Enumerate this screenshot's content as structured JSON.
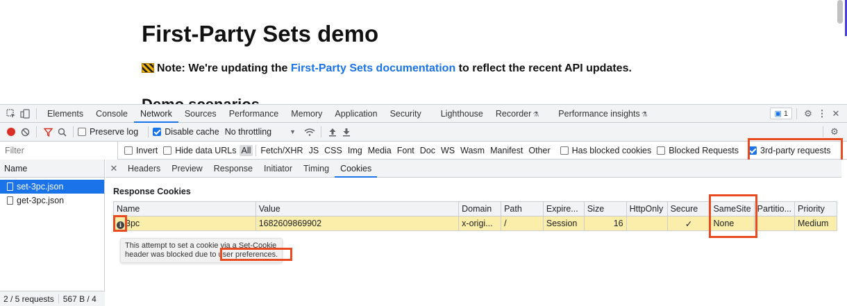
{
  "page": {
    "title": "First-Party Sets demo",
    "note_prefix": "Note: We're updating the ",
    "note_link": "First-Party Sets documentation",
    "note_suffix": " to reflect the recent API updates.",
    "partial_heading": "Demo scenarios"
  },
  "devtools": {
    "tabs": [
      "Elements",
      "Console",
      "Network",
      "Sources",
      "Performance",
      "Memory",
      "Application",
      "Security",
      "Lighthouse",
      "Recorder",
      "Performance insights"
    ],
    "active_tab": "Network",
    "issues_count": "1",
    "toolbar": {
      "preserve_log": "Preserve log",
      "disable_cache": "Disable cache",
      "throttling": "No throttling"
    },
    "filter": {
      "placeholder": "Filter",
      "invert": "Invert",
      "hide_data_urls": "Hide data URLs",
      "types": [
        "All",
        "Fetch/XHR",
        "JS",
        "CSS",
        "Img",
        "Media",
        "Font",
        "Doc",
        "WS",
        "Wasm",
        "Manifest",
        "Other"
      ],
      "has_blocked_cookies": "Has blocked cookies",
      "blocked_requests": "Blocked Requests",
      "third_party": "3rd-party requests"
    },
    "requests": {
      "header": "Name",
      "items": [
        "set-3pc.json",
        "get-3pc.json"
      ],
      "status_count": "2 / 5 requests",
      "status_size": "567 B / 4"
    },
    "detail": {
      "tabs": [
        "Headers",
        "Preview",
        "Response",
        "Initiator",
        "Timing",
        "Cookies"
      ],
      "active_tab": "Cookies",
      "section_title": "Response Cookies",
      "columns": [
        "Name",
        "Value",
        "Domain",
        "Path",
        "Expire...",
        "Size",
        "HttpOnly",
        "Secure",
        "SameSite",
        "Partitio...",
        "Priority"
      ],
      "row": {
        "name": "3pc",
        "value": "1682609869902",
        "domain": "x-origi...",
        "path": "/",
        "expires": "Session",
        "size": "16",
        "httponly": "",
        "secure": "✓",
        "samesite": "None",
        "partition": "",
        "priority": "Medium"
      },
      "tooltip_line1": "This attempt to set a cookie via a Set-Cookie",
      "tooltip_line2_prefix": "header was blocked due to ",
      "tooltip_line2_highlight": "user preferences."
    }
  },
  "colors": {
    "accent": "#1a73e8",
    "highlight": "#ea4a1f",
    "blocked_row": "#fbeeab"
  }
}
